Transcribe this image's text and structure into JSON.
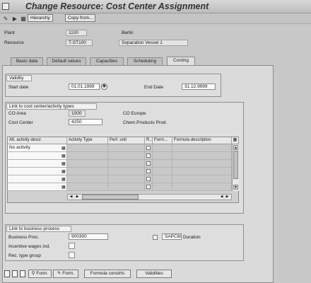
{
  "window": {
    "title": "Change Resource: Cost Center Assignment"
  },
  "toolbar": {
    "hierarchy_label": "Hierarchy",
    "copy_label": "Copy from..."
  },
  "header": {
    "plant_label": "Plant",
    "plant_value": "1100",
    "plant_desc": "Berlin",
    "resource_label": "Resource",
    "resource_value": "T-ST100",
    "resource_desc": "Separation Vessel 1"
  },
  "tabs": [
    {
      "label": "Basic data"
    },
    {
      "label": "Default values"
    },
    {
      "label": "Capacities"
    },
    {
      "label": "Scheduling"
    },
    {
      "label": "Costing"
    }
  ],
  "validity": {
    "title": "Validity",
    "start_label": "Start date",
    "start_value": "01.01.1999",
    "end_label": "End Date",
    "end_value": "31.12.9999"
  },
  "link_cost": {
    "title": "Link to cost center/activity types",
    "co_area_label": "CO Area",
    "co_area_value": "1000",
    "co_area_desc": "CO Europe",
    "cost_center_label": "Cost Center",
    "cost_center_value": "4250",
    "cost_center_desc": "Chem.Products Prod."
  },
  "table": {
    "headers": [
      "Alt. activity descr.",
      "Activity Type",
      "Perf. unit",
      "R..",
      "Form...",
      "Formula description"
    ],
    "rows": [
      {
        "descr": "No activity"
      },
      {
        "descr": ""
      },
      {
        "descr": ""
      },
      {
        "descr": ""
      },
      {
        "descr": ""
      },
      {
        "descr": ""
      }
    ]
  },
  "business": {
    "title": "Link to business process",
    "proc_label": "Business Proc.",
    "proc_value": "900300",
    "duration_code": "SAPC60",
    "duration_label": "Duration",
    "wages_label": "Incentive wages ind.",
    "rec_label": "Rec. type group"
  },
  "bottom_buttons": {
    "form1_label": "Form.",
    "form2_label": "Form.",
    "constraints_label": "Formula constrts",
    "validities_label": "Validities"
  }
}
